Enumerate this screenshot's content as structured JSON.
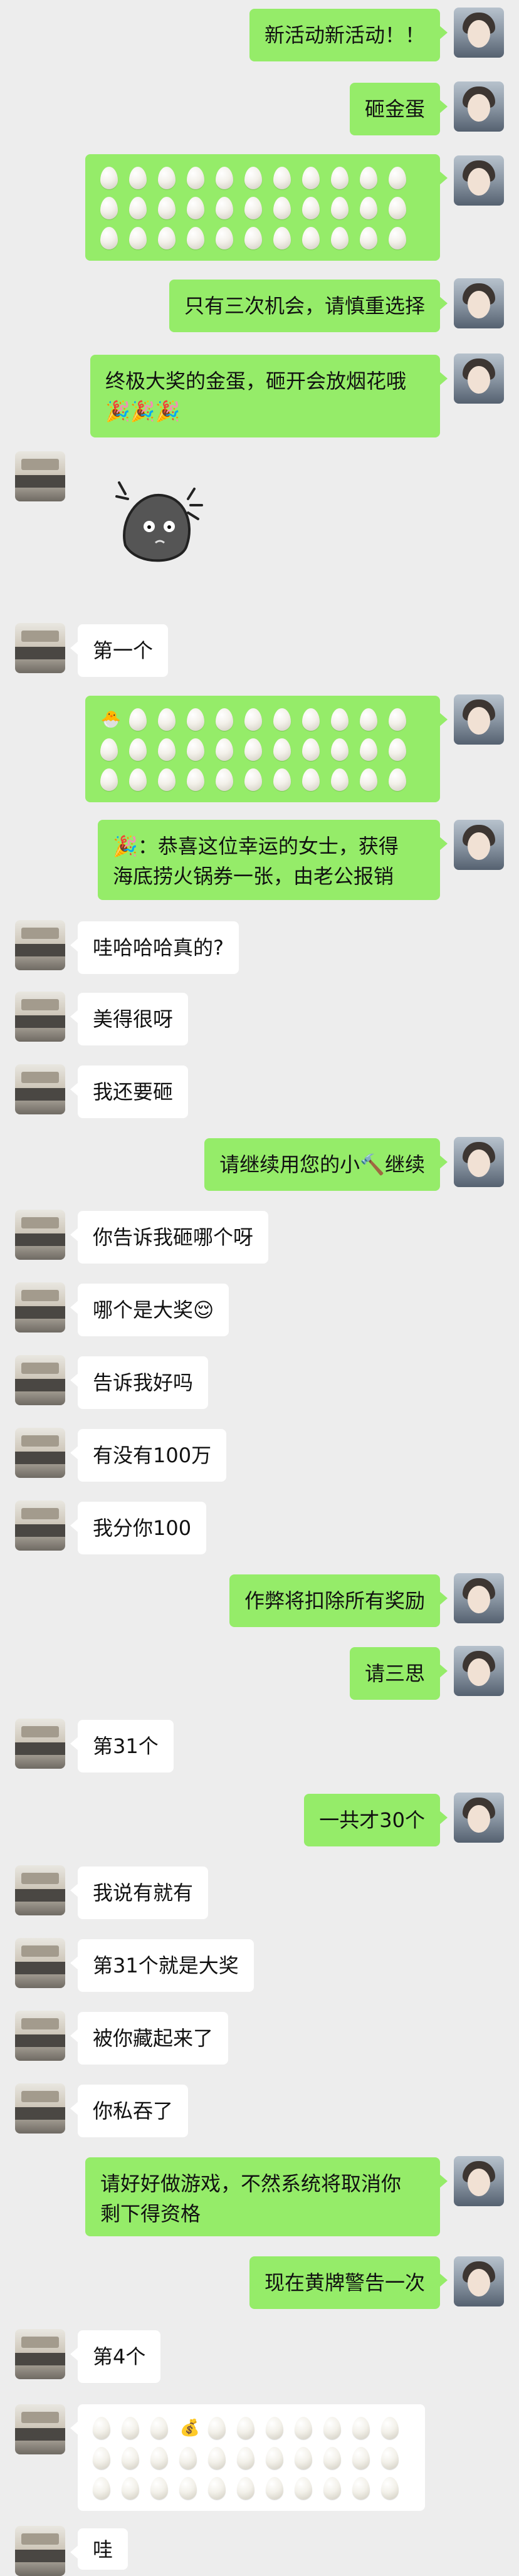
{
  "messages": [
    {
      "side": "me",
      "text": "新活动新活动！！"
    },
    {
      "side": "me",
      "text": "砸金蛋"
    },
    {
      "side": "me",
      "text": ""
    },
    {
      "side": "me",
      "text": "只有三次机会，请慎重选择"
    },
    {
      "side": "me",
      "line1": "终极大奖的金蛋，砸开会放烟花哦",
      "line2": "🎉🎉🎉"
    },
    {
      "side": "them",
      "text": ""
    },
    {
      "side": "them",
      "text": "第一个"
    },
    {
      "side": "me",
      "text": ""
    },
    {
      "side": "me",
      "line1": "🎉：恭喜这位幸运的女士，获得",
      "line2": "海底捞火锅券一张，由老公报销"
    },
    {
      "side": "them",
      "text": "哇哈哈哈真的?"
    },
    {
      "side": "them",
      "text": "美得很呀"
    },
    {
      "side": "them",
      "text": "我还要砸"
    },
    {
      "side": "me",
      "text": "请继续用您的小🔨继续"
    },
    {
      "side": "them",
      "text": "你告诉我砸哪个呀"
    },
    {
      "side": "them",
      "text": "哪个是大奖😌"
    },
    {
      "side": "them",
      "text": "告诉我好吗"
    },
    {
      "side": "them",
      "text": "有没有100万"
    },
    {
      "side": "them",
      "text": "我分你100"
    },
    {
      "side": "me",
      "text": "作弊将扣除所有奖励"
    },
    {
      "side": "me",
      "text": "请三思"
    },
    {
      "side": "them",
      "text": "第31个"
    },
    {
      "side": "me",
      "text": "一共才30个"
    },
    {
      "side": "them",
      "text": "我说有就有"
    },
    {
      "side": "them",
      "text": "第31个就是大奖"
    },
    {
      "side": "them",
      "text": "被你藏起来了"
    },
    {
      "side": "them",
      "text": "你私吞了"
    },
    {
      "side": "me",
      "line1": "请好好做游戏，不然系统将取消你",
      "line2": "剩下得资格"
    },
    {
      "side": "me",
      "text": "现在黄牌警告一次"
    },
    {
      "side": "them",
      "text": "第4个"
    },
    {
      "side": "them",
      "text": ""
    },
    {
      "side": "them",
      "text": "哇"
    }
  ],
  "egg_grids": {
    "grid1": {
      "rows": 3,
      "cols": 11,
      "specials": []
    },
    "grid2": {
      "rows": 3,
      "cols": 11,
      "specials": [
        {
          "index": 0,
          "glyph": "🐣"
        }
      ]
    },
    "grid3": {
      "rows": 3,
      "cols": 11,
      "specials": [
        {
          "index": 3,
          "glyph": "💰"
        }
      ]
    }
  }
}
